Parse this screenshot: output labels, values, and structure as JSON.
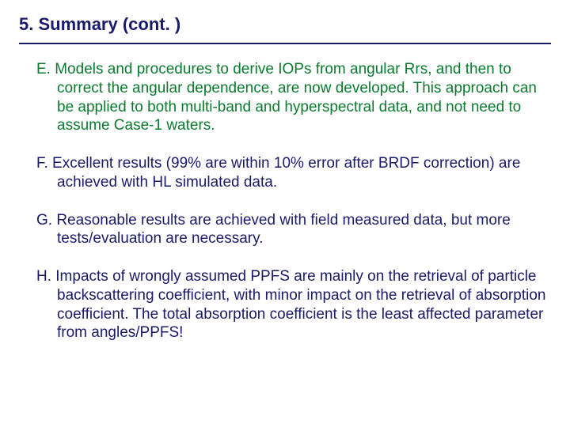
{
  "heading": "5. Summary (cont. )",
  "items": {
    "e": "E. Models and procedures to derive IOPs from angular Rrs, and then to correct the angular dependence, are now developed. This approach can be applied to both multi-band and hyperspectral data, and not need to assume Case-1 waters.",
    "f": "F.  Excellent results (99% are within 10% error after BRDF correction) are achieved with HL simulated data.",
    "g": "G.  Reasonable results are achieved with field measured data, but more tests/evaluation are necessary.",
    "h": "H.  Impacts of wrongly assumed PPFS are mainly on the retrieval of particle backscattering coefficient, with minor impact on the retrieval of absorption coefficient. The total absorption coefficient is the least affected parameter from angles/PPFS!"
  }
}
